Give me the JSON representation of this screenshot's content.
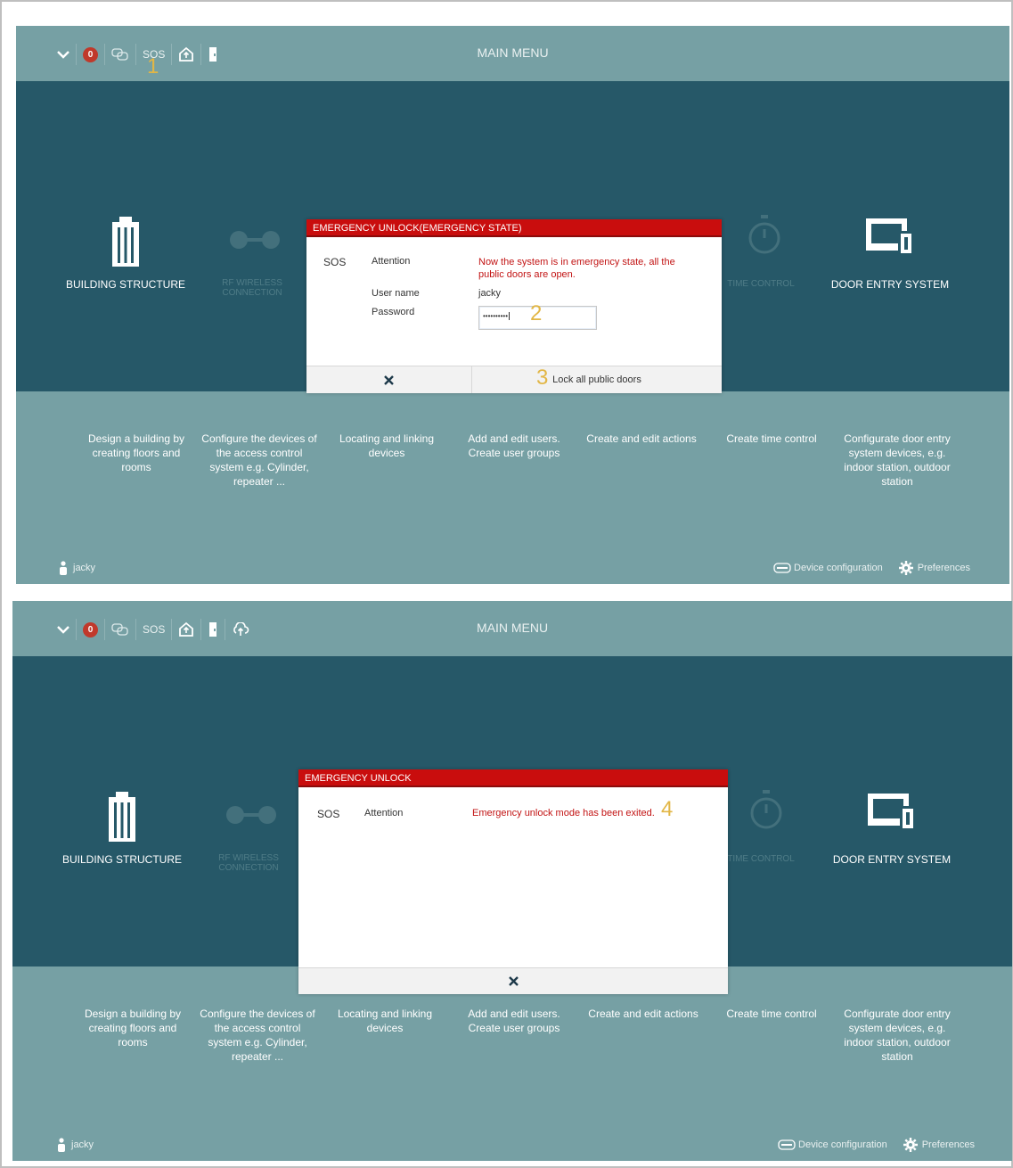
{
  "header": {
    "title": "MAIN MENU",
    "sos_label": "SOS",
    "alarm_count": "0"
  },
  "tiles": [
    {
      "label": "BUILDING STRUCTURE"
    },
    {
      "label": "RF WIRELESS CONNECTION"
    },
    {
      "label": "TIME CONTROL"
    },
    {
      "label": "DOOR ENTRY SYSTEM"
    }
  ],
  "descriptions": [
    "Design a building by creating floors and rooms",
    "Configure the devices of the access control system e.g. Cylinder, repeater ...",
    "Locating and linking devices",
    "Add and edit users. Create user groups",
    "Create and edit actions",
    "Create time control",
    "Configurate door entry system devices, e.g. indoor station, outdoor station"
  ],
  "footer": {
    "user": "jacky",
    "device_configuration": "Device configuration",
    "preferences": "Preferences"
  },
  "dialog1": {
    "title": "EMERGENCY UNLOCK(EMERGENCY STATE)",
    "sos": "SOS",
    "attention_label": "Attention",
    "attention_text": "Now the system is in emergency state, all the public doors are open.",
    "username_label": "User name",
    "username_value": "jacky",
    "password_label": "Password",
    "password_value": "••••••••••",
    "lock_button": "Lock all public doors"
  },
  "dialog2": {
    "title": "EMERGENCY UNLOCK",
    "sos": "SOS",
    "attention_label": "Attention",
    "attention_text": "Emergency unlock mode has been exited."
  },
  "steps": [
    "1",
    "2",
    "3",
    "4"
  ],
  "colors": {
    "background": "#76a0a4",
    "band": "#265868",
    "dialog_header": "#c90d0d",
    "alert_text": "#c21313",
    "step_marker": "#e2b645"
  },
  "icons": {
    "chevron": "chevron-down-icon",
    "alarm": "alarm-badge-icon",
    "messages": "chat-icon",
    "home": "house-up-icon",
    "door": "door-icon",
    "cloud": "cloud-upload-icon",
    "user": "person-icon",
    "device": "device-config-icon",
    "preferences": "gear-icon"
  }
}
